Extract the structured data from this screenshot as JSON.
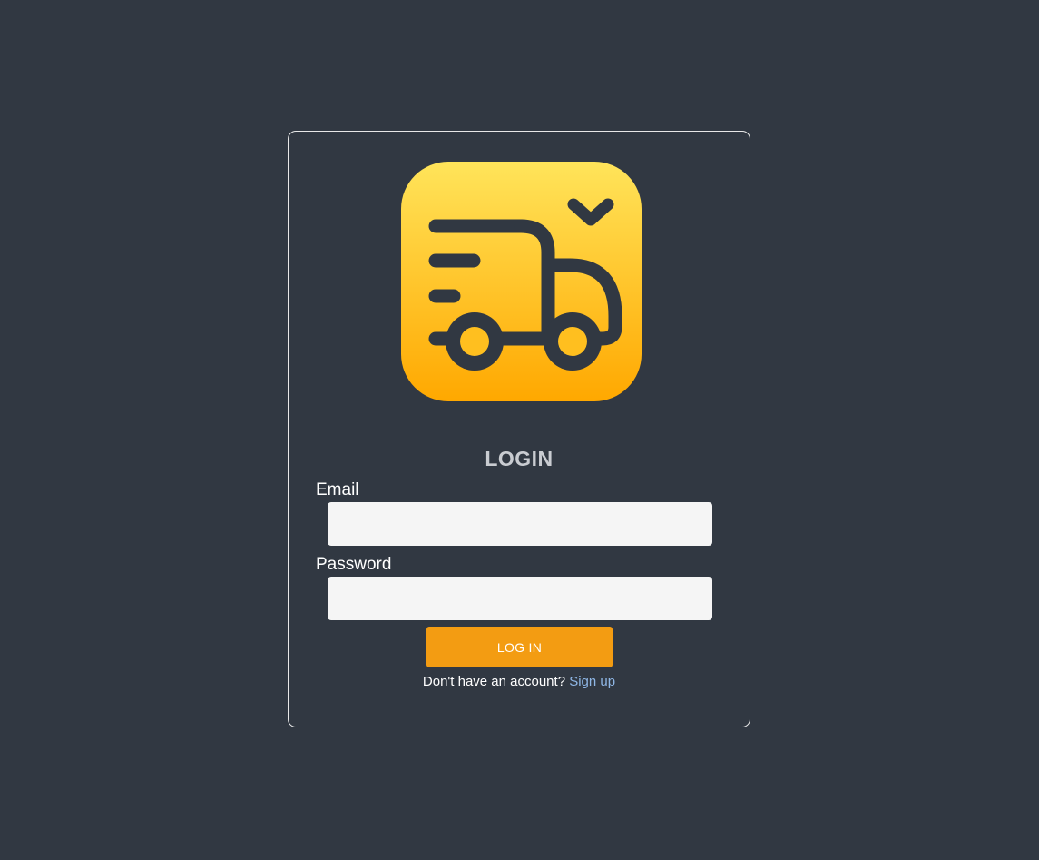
{
  "logo": {
    "icon": "delivery-truck-icon",
    "colors": {
      "top": "#ffe45a",
      "bottom": "#ffa800",
      "stroke": "#313842"
    }
  },
  "form": {
    "title": "LOGIN",
    "email_label": "Email",
    "email_value": "",
    "password_label": "Password",
    "password_value": "",
    "login_button": "LOG IN",
    "signup_prompt": "Don't have an account?",
    "signup_link": "Sign up"
  },
  "colors": {
    "background": "#313842",
    "accent": "#f39c12",
    "link": "#8fb7e6"
  }
}
